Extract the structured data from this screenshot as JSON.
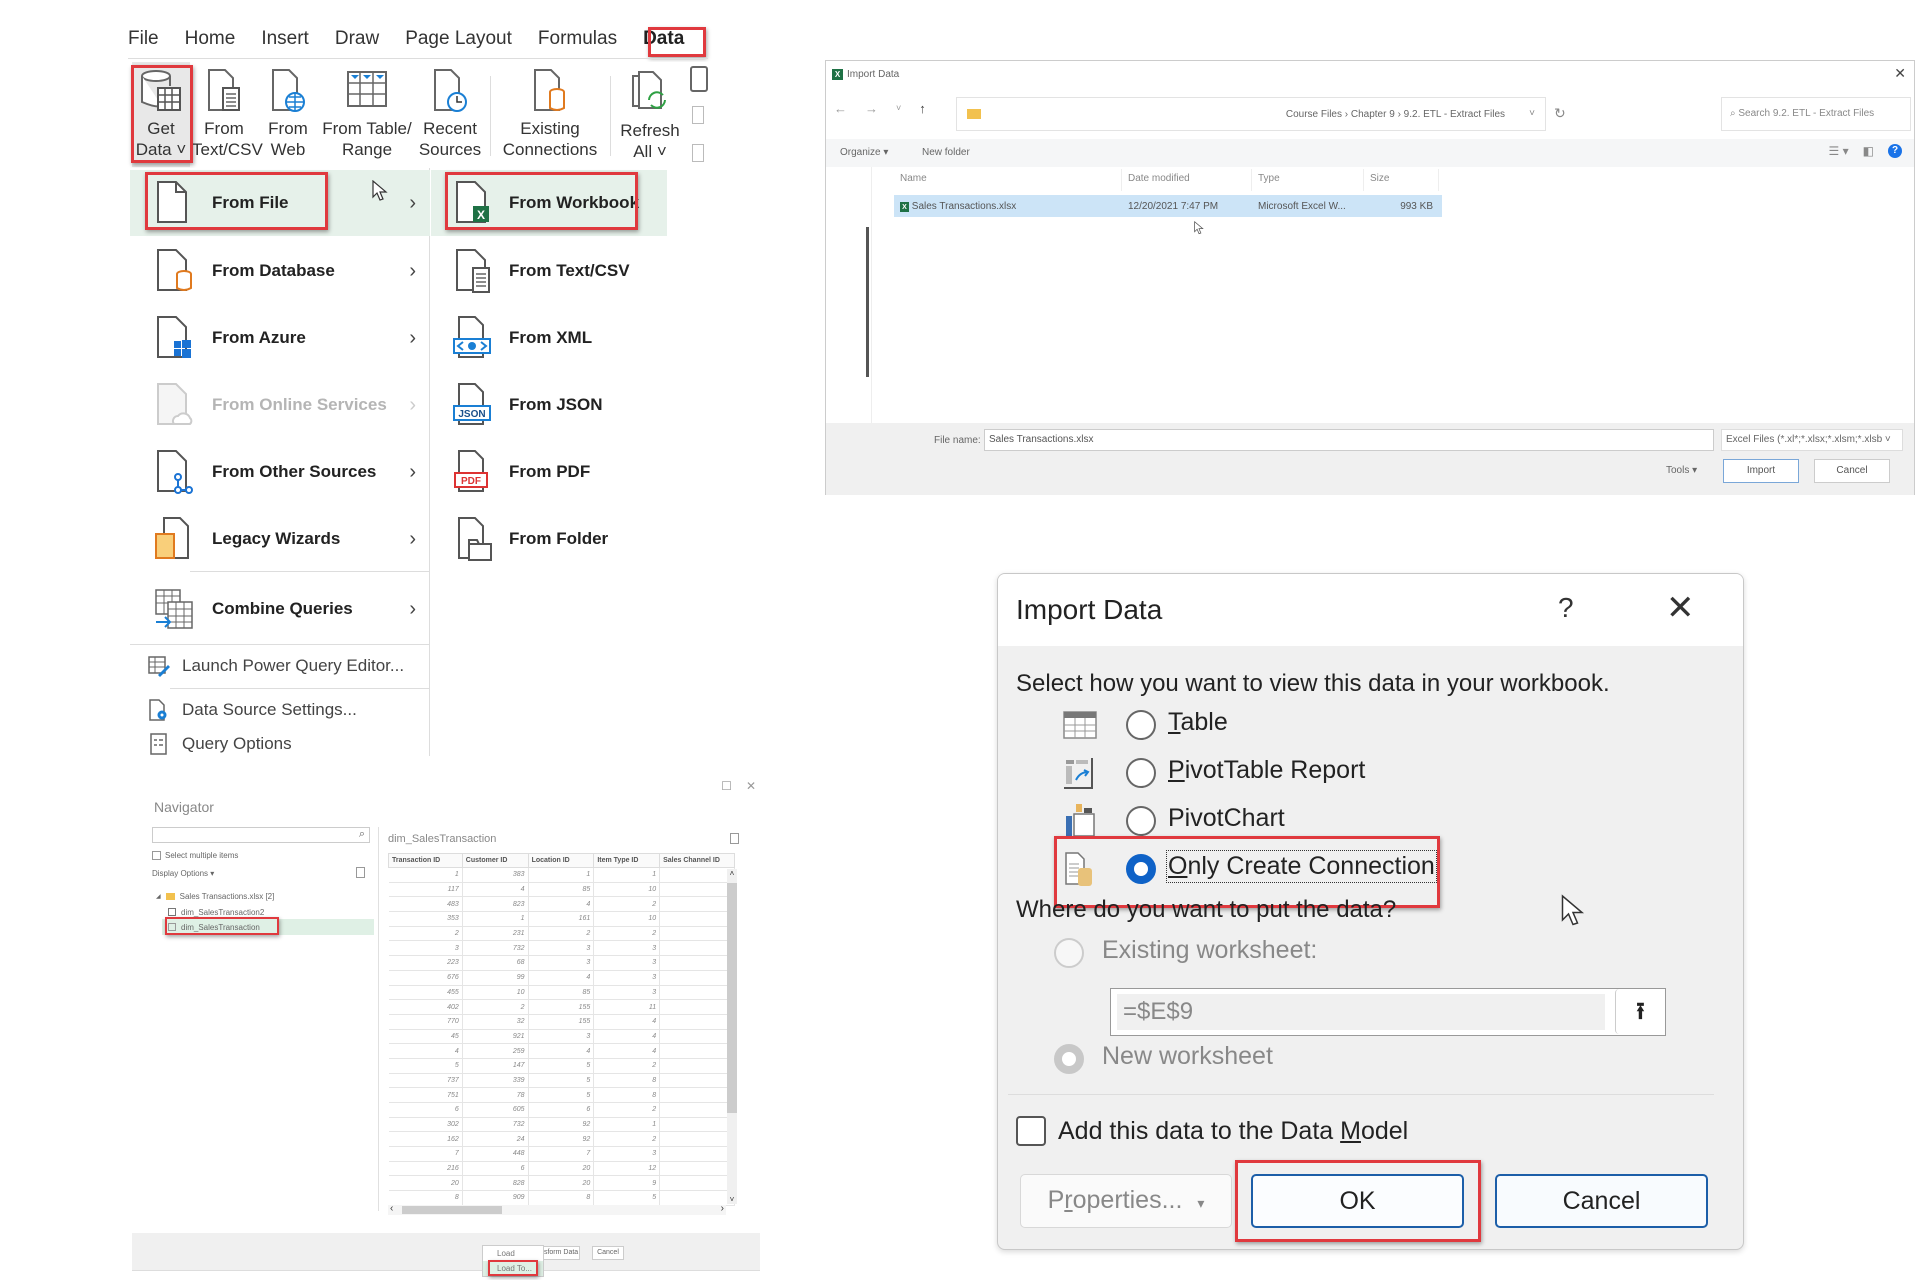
{
  "ribbon": {
    "tabs": [
      "File",
      "Home",
      "Insert",
      "Draw",
      "Page Layout",
      "Formulas",
      "Data"
    ],
    "active_tab": "Data",
    "buttons": {
      "get_data": [
        "Get",
        "Data ˅"
      ],
      "from_text_csv": [
        "From",
        "Text/CSV"
      ],
      "from_web": [
        "From",
        "Web"
      ],
      "from_table_range": [
        "From Table/",
        "Range"
      ],
      "recent_sources": [
        "Recent",
        "Sources"
      ],
      "existing_connections": [
        "Existing",
        "Connections"
      ],
      "refresh_all": [
        "Refresh",
        "All ˅"
      ]
    }
  },
  "get_data_menu": {
    "items": [
      {
        "label": "From File",
        "has_submenu": true,
        "highlighted": true
      },
      {
        "label": "From Database",
        "has_submenu": true
      },
      {
        "label": "From Azure",
        "has_submenu": true
      },
      {
        "label": "From Online Services",
        "has_submenu": true,
        "disabled": true
      },
      {
        "label": "From Other Sources",
        "has_submenu": true
      },
      {
        "label": "Legacy Wizards",
        "has_submenu": true
      },
      {
        "label": "Combine Queries",
        "has_submenu": true
      }
    ],
    "small_items": [
      "Launch Power Query Editor...",
      "Data Source Settings...",
      "Query Options"
    ],
    "submenu": [
      {
        "label": "From Workbook",
        "highlighted": true
      },
      {
        "label": "From Text/CSV"
      },
      {
        "label": "From XML"
      },
      {
        "label": "From JSON"
      },
      {
        "label": "From PDF"
      },
      {
        "label": "From Folder"
      }
    ],
    "chevron": "›"
  },
  "file_dialog": {
    "title": "Import Data",
    "path": "Course Files  ›  Chapter 9  ›  9.2. ETL - Extract Files",
    "search_placeholder": "Search 9.2. ETL - Extract Files",
    "toolbar": {
      "organize": "Organize ▾",
      "new_folder": "New folder"
    },
    "columns": [
      "Name",
      "Date modified",
      "Type",
      "Size"
    ],
    "files": [
      {
        "name": "Sales Transactions.xlsx",
        "date_modified": "12/20/2021 7:47 PM",
        "type": "Microsoft Excel W...",
        "size": "993 KB",
        "selected": true
      }
    ],
    "file_name_label": "File name:",
    "file_name_value": "Sales Transactions.xlsx",
    "file_type_filter": "Excel Files (*.xl*;*.xlsx;*.xlsm;*.xlsb ˅",
    "tools_label": "Tools ▾",
    "import_button": "Import",
    "cancel_button": "Cancel",
    "close": "✕"
  },
  "navigator": {
    "title": "Navigator",
    "select_multiple": "Select multiple items",
    "display_options": "Display Options ▾",
    "tree": {
      "root": "Sales Transactions.xlsx [2]",
      "children": [
        {
          "label": "dim_SalesTransaction2",
          "selected": false
        },
        {
          "label": "dim_SalesTransaction",
          "selected": true
        }
      ]
    },
    "preview_title": "dim_SalesTransaction",
    "columns": [
      "Transaction ID",
      "Customer ID",
      "Location ID",
      "Item Type ID",
      "Sales Channel ID"
    ],
    "rows": [
      [
        "1",
        "383",
        "1",
        "1",
        ""
      ],
      [
        "117",
        "4",
        "85",
        "10",
        ""
      ],
      [
        "483",
        "823",
        "4",
        "2",
        ""
      ],
      [
        "353",
        "1",
        "161",
        "10",
        ""
      ],
      [
        "2",
        "231",
        "2",
        "2",
        ""
      ],
      [
        "3",
        "732",
        "3",
        "3",
        ""
      ],
      [
        "223",
        "68",
        "3",
        "3",
        ""
      ],
      [
        "676",
        "99",
        "4",
        "3",
        ""
      ],
      [
        "455",
        "10",
        "85",
        "3",
        ""
      ],
      [
        "402",
        "2",
        "155",
        "11",
        ""
      ],
      [
        "770",
        "32",
        "155",
        "4",
        ""
      ],
      [
        "45",
        "921",
        "3",
        "4",
        ""
      ],
      [
        "4",
        "259",
        "4",
        "4",
        ""
      ],
      [
        "5",
        "147",
        "5",
        "2",
        ""
      ],
      [
        "737",
        "339",
        "5",
        "8",
        ""
      ],
      [
        "751",
        "78",
        "5",
        "8",
        ""
      ],
      [
        "6",
        "605",
        "6",
        "2",
        ""
      ],
      [
        "302",
        "732",
        "92",
        "1",
        ""
      ],
      [
        "162",
        "24",
        "92",
        "2",
        ""
      ],
      [
        "7",
        "448",
        "7",
        "3",
        ""
      ],
      [
        "216",
        "6",
        "20",
        "12",
        ""
      ],
      [
        "20",
        "828",
        "20",
        "9",
        ""
      ],
      [
        "8",
        "909",
        "8",
        "5",
        ""
      ]
    ],
    "buttons": {
      "load": "Load",
      "load_dropdown": "▾",
      "transform": "Transform Data",
      "cancel": "Cancel"
    },
    "load_menu": [
      "Load",
      "Load To..."
    ],
    "window_buttons": [
      "☐",
      "✕"
    ]
  },
  "import_dialog": {
    "title": "Import Data",
    "help": "?",
    "close": "✕",
    "question_view": "Select how you want to view this data in your workbook.",
    "view_options": [
      {
        "label": "Table",
        "underline": "T",
        "selected": false
      },
      {
        "label": "PivotTable Report",
        "underline": "P",
        "selected": false
      },
      {
        "label": "PivotChart",
        "underline": "",
        "selected": false
      },
      {
        "label": "Only Create Connection",
        "underline": "O",
        "selected": true
      }
    ],
    "question_location": "Where do you want to put the data?",
    "location_options": [
      {
        "label": "Existing worksheet:",
        "selected": false,
        "disabled": true
      },
      {
        "label": "New worksheet",
        "selected": true,
        "disabled": true
      }
    ],
    "cell_reference": "=$E$9",
    "data_model_label": "Add this data to the Data Model",
    "data_model_checked": false,
    "properties_button": "Properties...",
    "ok_button": "OK",
    "cancel_button": "Cancel"
  },
  "colors": {
    "highlight_box": "#e0393e",
    "menu_hover": "#e6f1ea",
    "radio_selected": "#0f62c7",
    "button_border": "#1c5ea8",
    "excel_green": "#1e7145",
    "file_selected": "#cce4f7"
  }
}
